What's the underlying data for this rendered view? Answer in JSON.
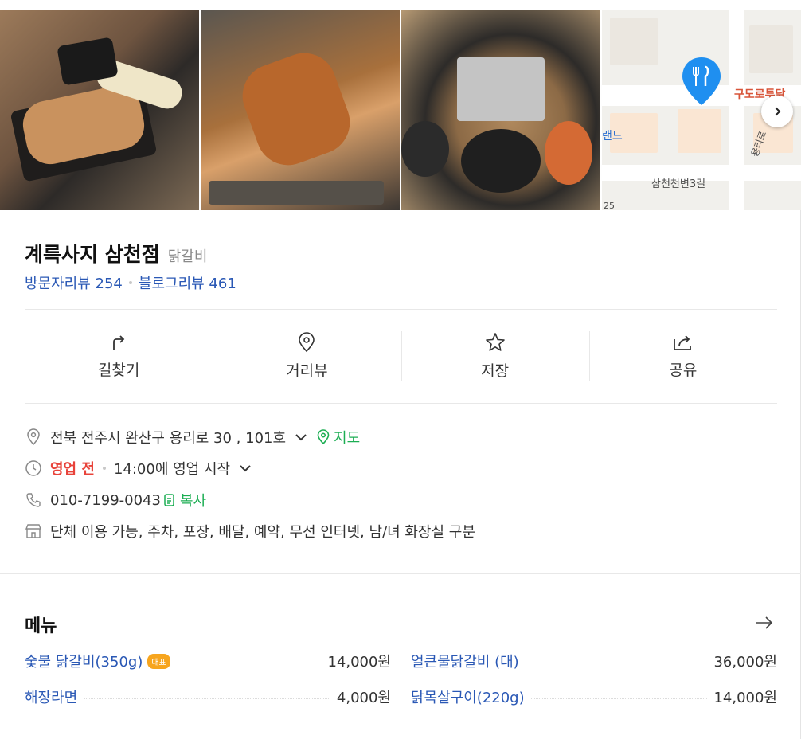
{
  "map": {
    "label_restaurant": "구도로투닭",
    "label_land": "랜드",
    "label_street": "삼천천변3길",
    "label_road": "용리로",
    "label_num": "25"
  },
  "place": {
    "name": "계륵사지 삼천점",
    "category": "닭갈비",
    "visitor_reviews": "방문자리뷰 254",
    "blog_reviews": "블로그리뷰 461"
  },
  "actions": [
    {
      "label": "길찾기",
      "icon": "directions-icon"
    },
    {
      "label": "거리뷰",
      "icon": "location-pin-icon"
    },
    {
      "label": "저장",
      "icon": "star-icon"
    },
    {
      "label": "공유",
      "icon": "share-icon"
    }
  ],
  "info": {
    "address": "전북 전주시 완산구 용리로 30 , 101호",
    "map_link": "지도",
    "status": "영업 전",
    "hours": "14:00에 영업 시작",
    "phone": "010-7199-0043",
    "copy_link": "복사",
    "amenities": "단체 이용 가능, 주차, 포장, 배달, 예약, 무선 인터넷, 남/녀 화장실 구분"
  },
  "menu": {
    "title": "메뉴",
    "items": [
      {
        "name": "숯불 닭갈비(350g)",
        "badge": "대표",
        "price": "14,000원"
      },
      {
        "name": "얼큰물닭갈비 (대)",
        "price": "36,000원"
      },
      {
        "name": "해장라면",
        "price": "4,000원"
      },
      {
        "name": "닭목살구이(220g)",
        "price": "14,000원"
      }
    ]
  },
  "colors": {
    "link_blue": "#2a58b5",
    "green": "#1cae53",
    "red": "#e8433a",
    "badge_orange": "#f7a51e"
  }
}
